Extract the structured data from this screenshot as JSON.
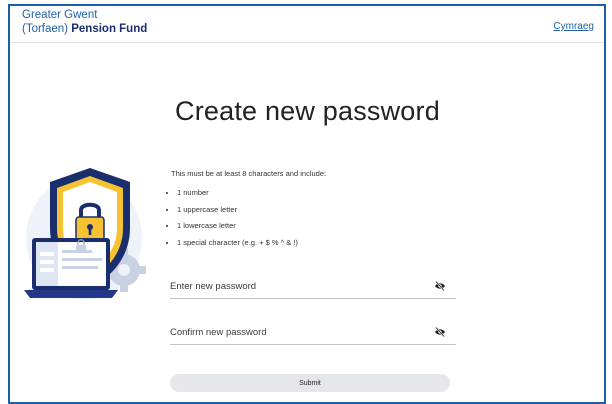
{
  "header": {
    "brand_line1": "Greater Gwent",
    "brand_line2_prefix": "(Torfaen)",
    "brand_line2_bold": "Pension Fund",
    "language_link": "Cymraeg"
  },
  "main": {
    "title": "Create new password",
    "intro": "This must be at least 8 characters and include:",
    "requirements": [
      "1 number",
      "1 uppercase letter",
      "1 lowercase letter",
      "1 special character (e.g. + $ % ^ & !)"
    ],
    "new_password_placeholder": "Enter new password",
    "confirm_password_placeholder": "Confirm new password",
    "submit_label": "Submit"
  },
  "icons": {
    "show_password": "eye-slash-icon",
    "illustration": "security-shield-laptop-illustration"
  },
  "colors": {
    "brand_blue": "#1f5fa8",
    "brand_navy": "#1a2e6e",
    "button_bg": "#e6e7eb",
    "shield_yellow": "#f6c232"
  }
}
